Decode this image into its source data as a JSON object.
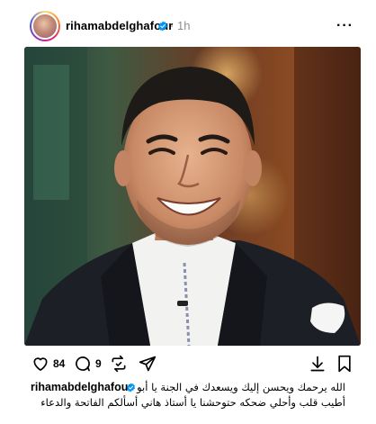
{
  "post": {
    "username": "rihamabdelghafour",
    "separator": "·",
    "time": "1h",
    "more_label": "···"
  },
  "actions": {
    "likes": "84",
    "comments": "9"
  },
  "caption": {
    "username": "rihamabdelghafour",
    "line1": "الله يرحمك ويحسن إليك ويسعدك في الجنة يا أبو",
    "line2": "أطيب قلب وأحلي ضحكه حتوحشنا يا أستاذ هاني أسألكم الفاتحة والدعاء"
  },
  "colors": {
    "verified": "#0095f6",
    "muted": "#8e8e8e"
  }
}
